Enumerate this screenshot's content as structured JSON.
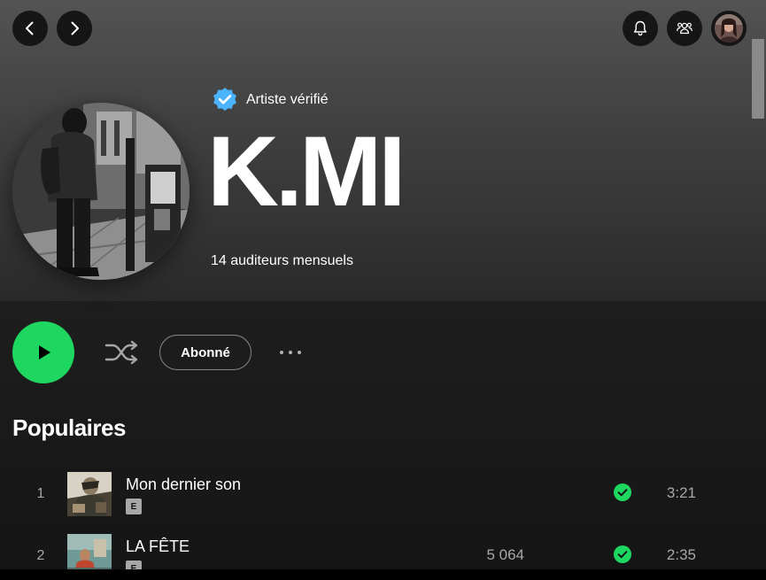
{
  "nav": {
    "back_icon": "chevron-left-icon",
    "forward_icon": "chevron-right-icon",
    "notifications_icon": "bell-icon",
    "friends_icon": "friends-activity-icon",
    "avatar_icon": "user-avatar"
  },
  "artist": {
    "verified_label": "Artiste vérifié",
    "name": "K.MI",
    "monthly_listeners": "14 auditeurs mensuels"
  },
  "actions": {
    "play_icon": "play-icon",
    "shuffle_icon": "shuffle-icon",
    "follow_label": "Abonné",
    "more_icon": "more-options-icon"
  },
  "popular": {
    "title": "Populaires",
    "tracks": [
      {
        "number": "1",
        "title": "Mon dernier son",
        "explicit": "E",
        "plays": "",
        "duration": "3:21",
        "saved": true
      },
      {
        "number": "2",
        "title": "LA FÊTE",
        "explicit": "E",
        "plays": "5 064",
        "duration": "2:35",
        "saved": true
      }
    ]
  },
  "colors": {
    "accent": "#1ed760",
    "verified_badge": "#4cb3ff",
    "background": "#121212"
  }
}
